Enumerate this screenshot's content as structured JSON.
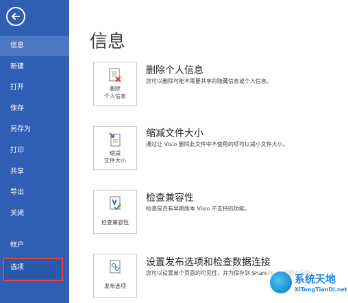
{
  "sidebar": {
    "items": [
      {
        "label": "信息"
      },
      {
        "label": "新建"
      },
      {
        "label": "打开"
      },
      {
        "label": "保存"
      },
      {
        "label": "另存为"
      },
      {
        "label": "打印"
      },
      {
        "label": "共享"
      },
      {
        "label": "导出"
      },
      {
        "label": "关闭"
      },
      {
        "label": "帐户"
      },
      {
        "label": "选项"
      }
    ]
  },
  "main": {
    "title": "信息",
    "sections": [
      {
        "button_label": "删除\n个人信息",
        "title": "删除个人信息",
        "desc": "您可以删除可能不需要共享的隐藏信息或个人信息。"
      },
      {
        "button_label": "缩减\n文件大小",
        "title": "缩减文件大小",
        "desc": "通过让 Visio 删除此文件中不使用的项可以减小文件大小。"
      },
      {
        "button_label": "检查兼容性",
        "title": "检查兼容性",
        "desc": "检查是否有早期版本 Visio 不支持的功能。"
      },
      {
        "button_label": "发布选项",
        "title": "设置发布选项和检查数据连接",
        "desc": "您可以设置单个页面的可见性，并为保存到 SharePoint 的图表配置"
      }
    ]
  },
  "watermark": {
    "text": "系统天地",
    "sub": "XiTongTianDi.net"
  },
  "colors": {
    "sidebar": "#2f5fb3",
    "active": "#4d78c3",
    "highlight_border": "#e24040"
  }
}
